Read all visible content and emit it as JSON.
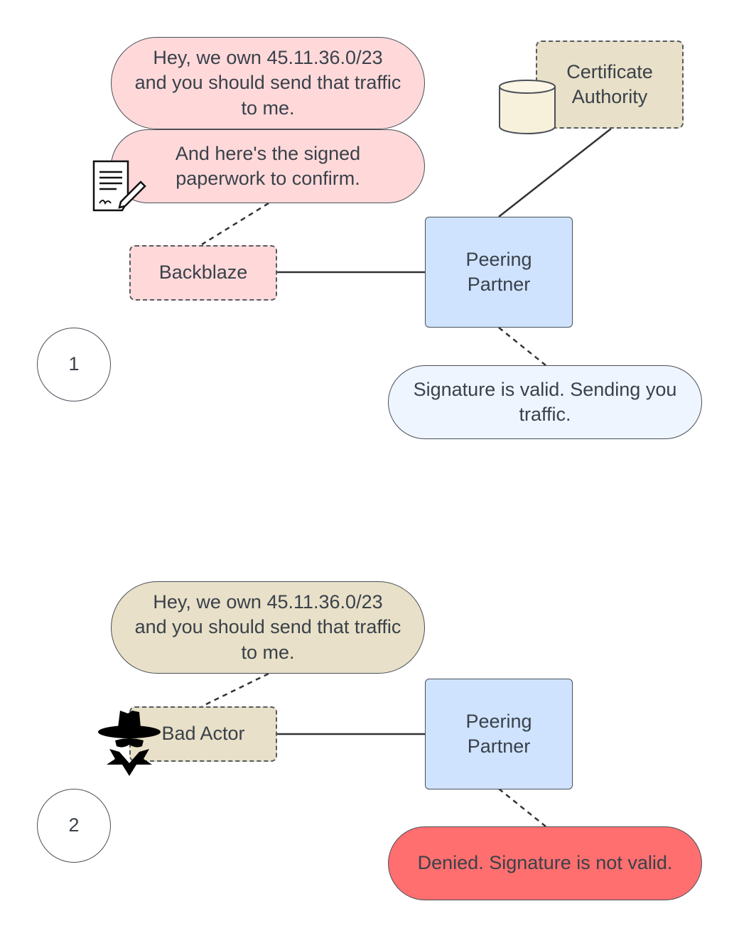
{
  "diagram": {
    "scenario1": {
      "step_label": "1",
      "claim_bubble": "Hey, we own 45.11.36.0/23 and you should send that traffic to me.",
      "claim_lines": [
        "Hey, we own 45.11.36.0/23",
        "and you should send that traffic",
        "to me."
      ],
      "paperwork_lines": [
        "And here's the signed",
        "paperwork to confirm."
      ],
      "sender": "Backblaze",
      "certificate_authority_lines": [
        "Certificate",
        "Authority"
      ],
      "peer_lines": [
        "Peering",
        "Partner"
      ],
      "response_lines": [
        "Signature is valid. Sending you",
        "traffic."
      ]
    },
    "scenario2": {
      "step_label": "2",
      "claim_lines": [
        "Hey, we own 45.11.36.0/23",
        "and you should send that traffic",
        "to me."
      ],
      "sender": "Bad Actor",
      "peer_lines": [
        "Peering",
        "Partner"
      ],
      "response": "Denied. Signature is not valid."
    },
    "icons": {
      "document": "signed-document-icon",
      "database": "database-icon",
      "spy": "spy-icon"
    },
    "colors": {
      "claim_pink": "#ffd9da",
      "tan": "#e8e0c8",
      "peer_blue": "#cfe3ff",
      "valid_blue": "#eef5ff",
      "denied_red": "#ff6f6f"
    }
  }
}
